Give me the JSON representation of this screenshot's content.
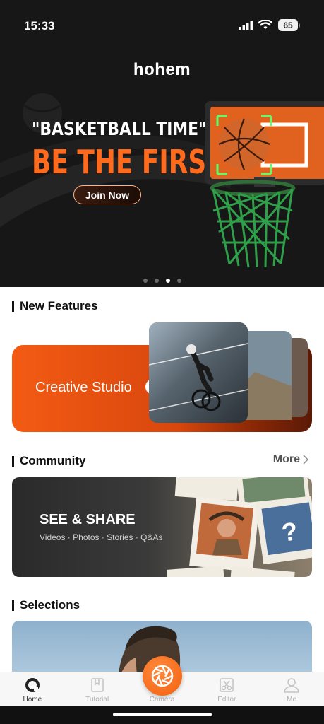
{
  "status_bar": {
    "time": "15:33",
    "battery": "65"
  },
  "hero": {
    "brand": "hohem",
    "headline_1": "\"BASKETBALL TIME\"",
    "headline_2": "BE THE FIRST",
    "cta_label": "Join Now",
    "slide_count": 4,
    "active_slide": 3,
    "accent": "#ff6a1c"
  },
  "sections": {
    "new_features": "New Features",
    "community": "Community",
    "selections": "Selections",
    "more_label": "More"
  },
  "feature_card": {
    "label": "Creative Studio"
  },
  "community_banner": {
    "title": "SEE & SHARE",
    "tags": "Videos · Photos · Stories · Q&As"
  },
  "tabs": [
    {
      "label": "Home",
      "icon": "home-icon",
      "active": true
    },
    {
      "label": "Tutorial",
      "icon": "book-icon",
      "active": false
    },
    {
      "label": "Camera",
      "icon": "shutter-icon",
      "active": false
    },
    {
      "label": "Editor",
      "icon": "scissors-icon",
      "active": false
    },
    {
      "label": "Me",
      "icon": "person-icon",
      "active": false
    }
  ]
}
